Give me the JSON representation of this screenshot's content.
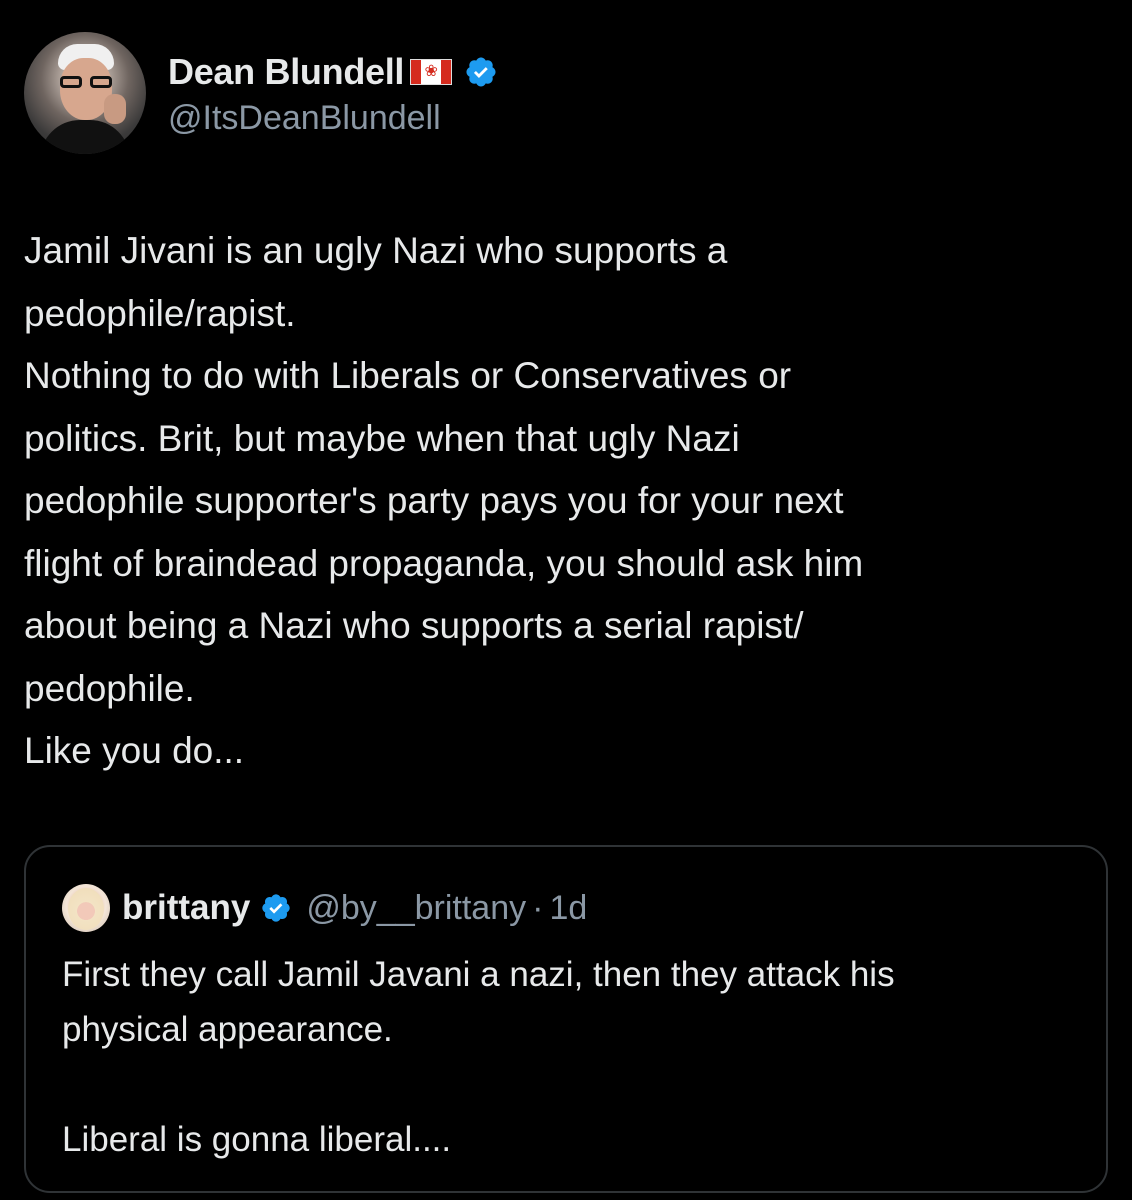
{
  "tweet": {
    "author": {
      "display_name": "Dean Blundell",
      "flag_icon": "canada-flag-icon",
      "verified_icon": "verified-badge-icon",
      "handle": "@ItsDeanBlundell"
    },
    "body_lines": [
      "Jamil Jivani is an ugly Nazi who supports a",
      "pedophile/rapist.",
      "Nothing to do with Liberals or Conservatives or",
      "politics. Brit, but maybe when that ugly Nazi",
      "pedophile supporter's party pays you for your next",
      "flight of braindead propaganda, you should ask him",
      "about being a Nazi who supports a serial rapist/",
      "pedophile.",
      "Like you do..."
    ],
    "quoted": {
      "display_name": "brittany",
      "handle": "@by__brittany",
      "separator": "·",
      "time": "1d",
      "text_lines": [
        "First they call Jamil Javani a nazi, then they attack his",
        "physical appearance.",
        "",
        "Liberal is gonna liberal...."
      ]
    }
  },
  "colors": {
    "background": "#000000",
    "primary_text": "#e7e9ea",
    "secondary_text": "#8b98a5",
    "verified_blue": "#1d9bf0",
    "border": "#2f3336"
  }
}
